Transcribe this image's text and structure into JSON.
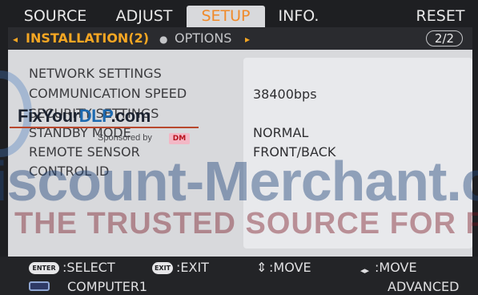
{
  "tabs": {
    "source": "SOURCE",
    "adjust": "ADJUST",
    "setup": "SETUP",
    "info": "INFO.",
    "reset": "RESET"
  },
  "subtabs": {
    "left_arrow": "◂",
    "active": "INSTALLATION(2)",
    "dot": "●",
    "other": "OPTIONS",
    "right_arrow": "▸",
    "page": "2/2"
  },
  "settings": [
    {
      "label": "NETWORK SETTINGS",
      "value": ""
    },
    {
      "label": "COMMUNICATION SPEED",
      "value": "38400bps"
    },
    {
      "label": "SECURITY SETTINGS",
      "value": ""
    },
    {
      "label": "STANDBY MODE",
      "value": "NORMAL"
    },
    {
      "label": "REMOTE SENSOR",
      "value": "FRONT/BACK"
    },
    {
      "label": "CONTROL ID",
      "value": ""
    }
  ],
  "watermark": {
    "site_dark": "FixYour",
    "site_blue": "DLP",
    "site_suffix": ".com",
    "sponsored": "Sponsored by",
    "dm": "DM",
    "discount": "iscount-Merchant.c",
    "trusted": "THE TRUSTED SOURCE FOR PROJEC"
  },
  "footer": {
    "enter_key": "ENTER",
    "select": ":SELECT",
    "exit_key": "EXIT",
    "exit": ":EXIT",
    "updown_symbol": "⇕",
    "move_vertical": ":MOVE",
    "leftright_symbol": "◂▸",
    "move_horizontal": ":MOVE",
    "input": "COMPUTER1",
    "menu_mode": "ADVANCED"
  },
  "colors": {
    "accent": "#f5a623",
    "panel": "#d8d9dc",
    "background": "#1e1f22"
  },
  "icons": {
    "input_source": "computer-input-icon"
  }
}
